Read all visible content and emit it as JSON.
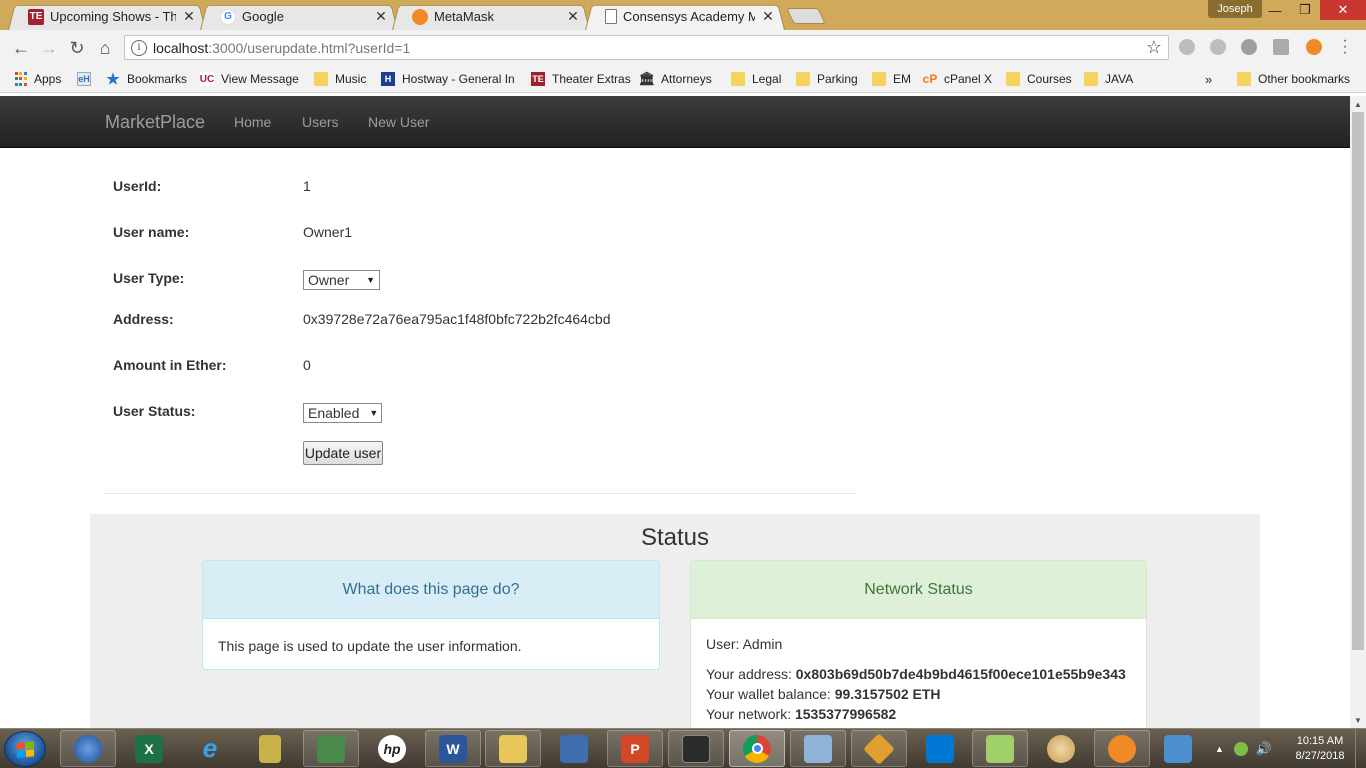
{
  "browser": {
    "tabs": [
      {
        "title": "Upcoming Shows - Theat",
        "active": false
      },
      {
        "title": "Google",
        "active": false
      },
      {
        "title": "MetaMask",
        "active": false
      },
      {
        "title": "Consensys Academy Mar",
        "active": true
      }
    ],
    "profile_name": "Joseph",
    "url_host": "localhost",
    "url_rest": ":3000/userupdate.html?userId=1",
    "bookmarks": [
      {
        "label": "Apps",
        "icon": "apps-grid-icon"
      },
      {
        "label": "",
        "icon": "eh-icon"
      },
      {
        "label": "Bookmarks",
        "icon": "star-icon"
      },
      {
        "label": "View Message",
        "icon": "uc-icon"
      },
      {
        "label": "Music",
        "icon": "folder-icon"
      },
      {
        "label": "Hostway - General In",
        "icon": "hostway-icon"
      },
      {
        "label": "Theater Extras",
        "icon": "te-icon"
      },
      {
        "label": "Attorneys",
        "icon": "courthouse-icon"
      },
      {
        "label": "Legal",
        "icon": "folder-icon"
      },
      {
        "label": "Parking",
        "icon": "folder-icon"
      },
      {
        "label": "EM",
        "icon": "folder-icon"
      },
      {
        "label": "cPanel X",
        "icon": "cpanel-icon"
      },
      {
        "label": "Courses",
        "icon": "folder-icon"
      },
      {
        "label": "JAVA",
        "icon": "folder-icon"
      }
    ],
    "bookmarks_overflow": "»",
    "other_bookmarks": "Other bookmarks"
  },
  "app": {
    "brand": "MarketPlace",
    "nav": [
      "Home",
      "Users",
      "New User"
    ]
  },
  "form": {
    "userid_label": "UserId:",
    "userid_value": "1",
    "username_label": "User name:",
    "username_value": "Owner1",
    "usertype_label": "User Type:",
    "usertype_value": "Owner",
    "address_label": "Address:",
    "address_value": "0x39728e72a76ea795ac1f48f0bfc722b2fc464cbd",
    "amount_label": "Amount in Ether:",
    "amount_value": "0",
    "status_label": "User Status:",
    "status_value": "Enabled",
    "update_button": "Update user"
  },
  "status": {
    "title": "Status",
    "info_panel": {
      "heading": "What does this page do?",
      "body": "This page is used to update the user information."
    },
    "network_panel": {
      "heading": "Network Status",
      "user_line": "User: Admin",
      "address_label": "Your address: ",
      "address_value": "0x803b69d50b7de4b9bd4615f00ece101e55b9e343",
      "balance_label": "Your wallet balance: ",
      "balance_value": "99.3157502 ETH",
      "network_label": "Your network: ",
      "network_value": "1535377996582"
    }
  },
  "taskbar": {
    "time": "10:15 AM",
    "date": "8/27/2018",
    "apps": [
      "thunderbird",
      "excel",
      "internet-explorer",
      "keepass",
      "network-tool",
      "hp",
      "word",
      "file-explorer",
      "remote-desktop",
      "powerpoint",
      "terminal",
      "chrome",
      "resource-monitor",
      "git-gui",
      "vs-code",
      "notepad-plus-plus",
      "paint",
      "metamask-fox",
      "image-viewer"
    ]
  },
  "colors": {
    "navbar": "#222222",
    "info_panel_bg": "#d9edf7",
    "info_panel_text": "#31708f",
    "success_panel_bg": "#dff0d8",
    "success_panel_text": "#3c763d",
    "status_area_bg": "#eeeeee"
  }
}
